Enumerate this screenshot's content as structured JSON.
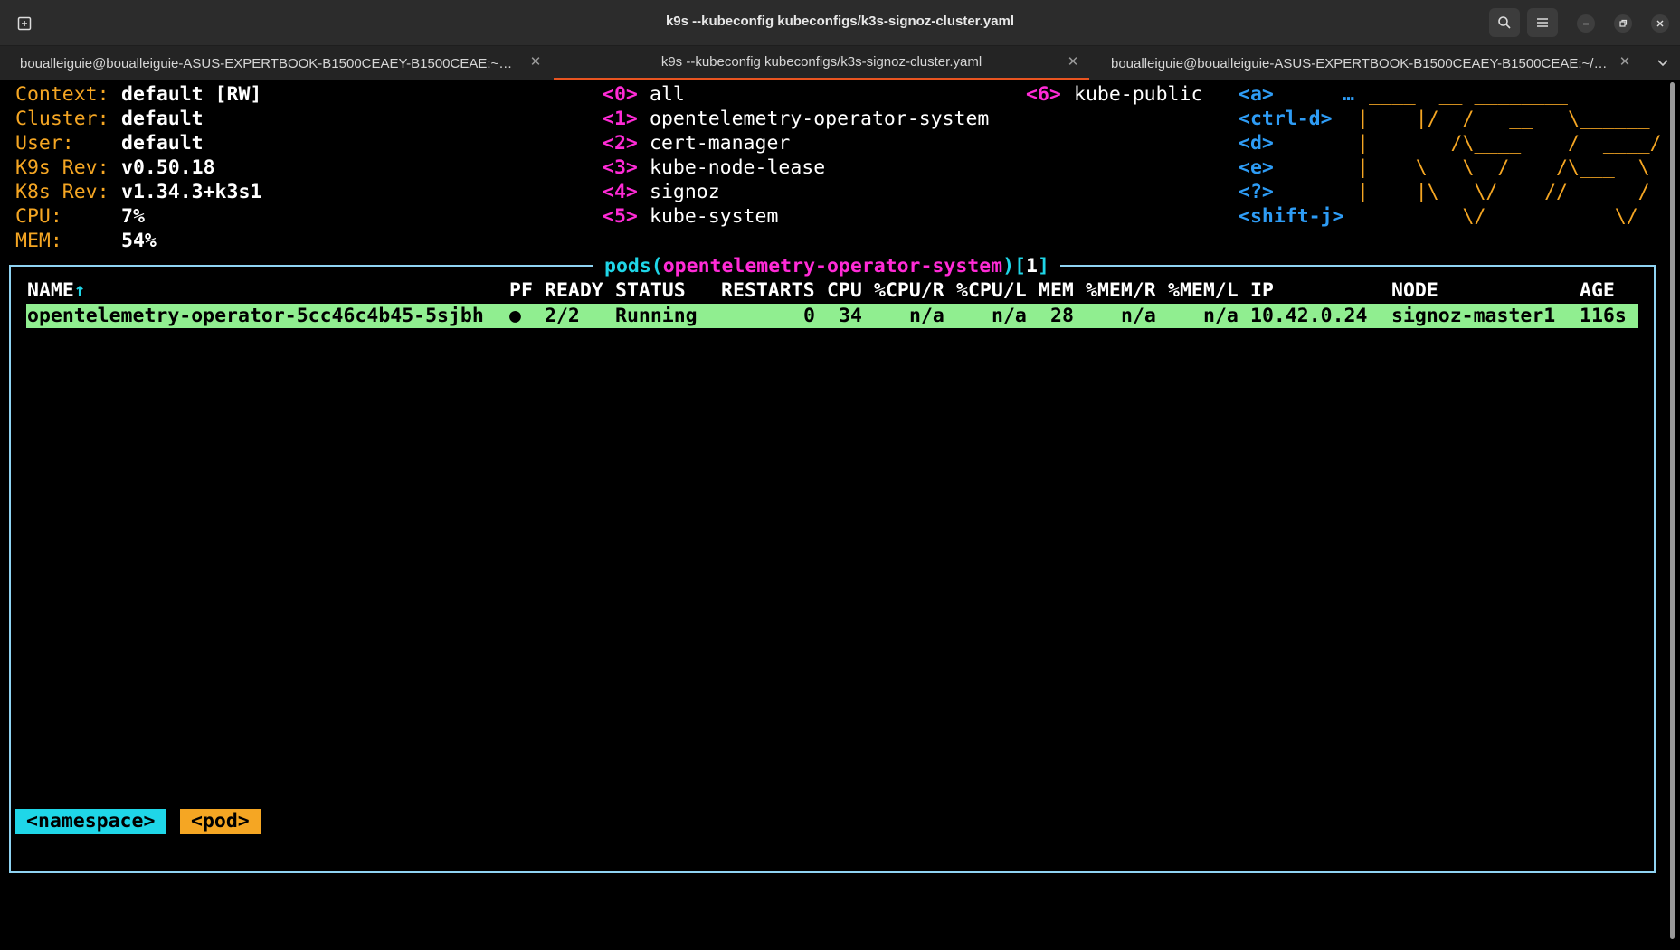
{
  "window": {
    "title": "k9s --kubeconfig kubeconfigs/k3s-signoz-cluster.yaml"
  },
  "tabs": [
    {
      "label": "boualleiguie@boualleiguie-ASUS-EXPERTBOOK-B1500CEAEY-B1500CEAE:~/Des…",
      "active": false
    },
    {
      "label": "k9s --kubeconfig kubeconfigs/k3s-signoz-cluster.yaml",
      "active": true
    },
    {
      "label": "boualleiguie@boualleiguie-ASUS-EXPERTBOOK-B1500CEAEY-B1500CEAE:~/Des…",
      "active": false
    }
  ],
  "cluster_info": [
    {
      "key": "Context:",
      "value": "default [RW]"
    },
    {
      "key": "Cluster:",
      "value": "default"
    },
    {
      "key": "User:",
      "value": "default"
    },
    {
      "key": "K9s Rev:",
      "value": "v0.50.18"
    },
    {
      "key": "K8s Rev:",
      "value": "v1.34.3+k3s1"
    },
    {
      "key": "CPU:",
      "value": "7%"
    },
    {
      "key": "MEM:",
      "value": "54%"
    }
  ],
  "namespaces": [
    {
      "key": "<0>",
      "name": "all"
    },
    {
      "key": "<1>",
      "name": "opentelemetry-operator-system"
    },
    {
      "key": "<2>",
      "name": "cert-manager"
    },
    {
      "key": "<3>",
      "name": "kube-node-lease"
    },
    {
      "key": "<4>",
      "name": "signoz"
    },
    {
      "key": "<5>",
      "name": "kube-system"
    },
    {
      "key": "<6>",
      "name": "kube-public"
    }
  ],
  "shortcuts": [
    "<a>",
    "<ctrl-d>",
    "<d>",
    "<e>",
    "<?>",
    "<shift-j>"
  ],
  "logo": {
    "ellipsis": "…",
    "lines": [
      " ____  __ ________        ",
      "|    |/  /   __   \\______ ",
      "|       /\\____    /  ____/",
      "|    \\   \\  /    /\\___  \\ ",
      "|____|\\__ \\/____//____  / ",
      "         \\/           \\/  "
    ]
  },
  "panel": {
    "resource": "pods",
    "namespace": "opentelemetry-operator-system",
    "count": "1"
  },
  "table": {
    "columns": [
      "NAME↑",
      "PF",
      "READY",
      "STATUS",
      "RESTARTS",
      "CPU",
      "%CPU/R",
      "%CPU/L",
      "MEM",
      "%MEM/R",
      "%MEM/L",
      "IP",
      "NODE",
      "AGE"
    ],
    "rows": [
      [
        "opentelemetry-operator-5cc46c4b45-5sjbh",
        "●",
        "2/2",
        "Running",
        "0",
        "34",
        "n/a",
        "n/a",
        "28",
        "n/a",
        "n/a",
        "10.42.0.24",
        "signoz-master1",
        "116s"
      ]
    ]
  },
  "breadcrumbs": [
    "<namespace>",
    "<pod>"
  ],
  "colors": {
    "label": "#f5a623",
    "hotkey_ns": "#ff2bd6",
    "hotkey_action": "#2e9cf5",
    "title_cyan": "#1fd6e8",
    "row_highlight": "#90ee90",
    "crumb_namespace": "#1fd6e8",
    "crumb_pod": "#f5a623",
    "tab_accent": "#e95420"
  },
  "icons": {
    "new_tab": "new-tab-icon",
    "search": "search-icon",
    "menu": "hamburger-menu-icon",
    "minimize": "minimize-icon",
    "restore": "restore-icon",
    "close": "close-icon",
    "tab_close": "close-icon",
    "tab_overflow": "chevron-down-icon"
  }
}
